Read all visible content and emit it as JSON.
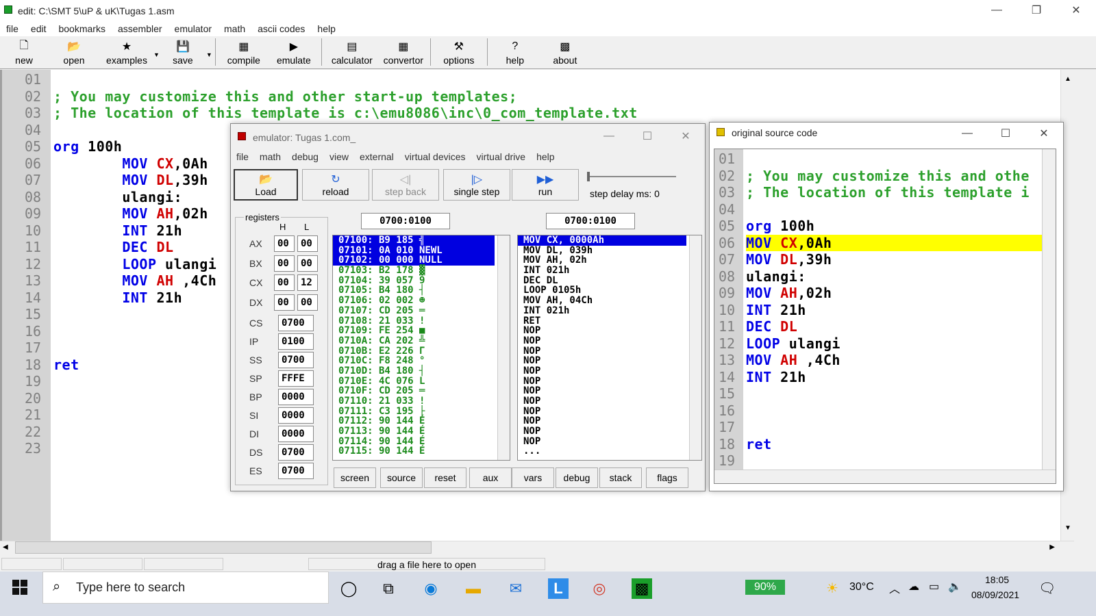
{
  "window": {
    "title": "edit: C:\\SMT 5\\uP & uK\\Tugas 1.asm",
    "min": "—",
    "max": "❐",
    "close": "✕"
  },
  "menu": [
    "file",
    "edit",
    "bookmarks",
    "assembler",
    "emulator",
    "math",
    "ascii codes",
    "help"
  ],
  "toolbar": [
    {
      "label": "new",
      "icon": "new-file-icon",
      "glyph": "🗋"
    },
    {
      "label": "open",
      "icon": "open-folder-icon",
      "glyph": "📂"
    },
    {
      "label": "examples",
      "icon": "star-icon",
      "glyph": "★"
    },
    {
      "label": "save",
      "icon": "floppy-disk-icon",
      "glyph": "💾"
    },
    {
      "label": "compile",
      "icon": "compile-icon",
      "glyph": "▦"
    },
    {
      "label": "emulate",
      "icon": "play-icon",
      "glyph": "▶"
    },
    {
      "label": "calculator",
      "icon": "calculator-icon",
      "glyph": "▤"
    },
    {
      "label": "convertor",
      "icon": "convertor-icon",
      "glyph": "▦"
    },
    {
      "label": "options",
      "icon": "tools-icon",
      "glyph": "⚒"
    },
    {
      "label": "help",
      "icon": "help-icon",
      "glyph": "?"
    },
    {
      "label": "about",
      "icon": "chip-icon",
      "glyph": "▩"
    }
  ],
  "editor": {
    "line_numbers": [
      "01",
      "02",
      "03",
      "04",
      "05",
      "06",
      "07",
      "08",
      "09",
      "10",
      "11",
      "12",
      "13",
      "14",
      "15",
      "16",
      "17",
      "18",
      "19",
      "20",
      "21",
      "22",
      "23"
    ],
    "lines": [
      [],
      [
        {
          "t": "; You may customize this and other start-up templates;",
          "c": "cmt"
        }
      ],
      [
        {
          "t": "; The location of this template is c:\\emu8086\\inc\\0_com_template.txt",
          "c": "cmt"
        }
      ],
      [],
      [
        {
          "t": "org ",
          "c": "kw"
        },
        {
          "t": "100h",
          "c": "txt"
        }
      ],
      [
        {
          "t": "        MOV ",
          "c": "kw"
        },
        {
          "t": "CX",
          "c": "reg"
        },
        {
          "t": ",0Ah",
          "c": "txt"
        }
      ],
      [
        {
          "t": "        MOV ",
          "c": "kw"
        },
        {
          "t": "DL",
          "c": "reg"
        },
        {
          "t": ",39h",
          "c": "txt"
        }
      ],
      [
        {
          "t": "        ulangi:",
          "c": "txt"
        }
      ],
      [
        {
          "t": "        MOV ",
          "c": "kw"
        },
        {
          "t": "AH",
          "c": "reg"
        },
        {
          "t": ",02h",
          "c": "txt"
        }
      ],
      [
        {
          "t": "        INT ",
          "c": "kw"
        },
        {
          "t": "21h",
          "c": "txt"
        }
      ],
      [
        {
          "t": "        DEC ",
          "c": "kw"
        },
        {
          "t": "DL",
          "c": "reg"
        }
      ],
      [
        {
          "t": "        LOOP ",
          "c": "kw"
        },
        {
          "t": "ulangi",
          "c": "txt"
        }
      ],
      [
        {
          "t": "        MOV ",
          "c": "kw"
        },
        {
          "t": "AH",
          "c": "reg"
        },
        {
          "t": " ,4Ch",
          "c": "txt"
        }
      ],
      [
        {
          "t": "        INT ",
          "c": "kw"
        },
        {
          "t": "21h",
          "c": "txt"
        }
      ],
      [],
      [],
      [],
      [
        {
          "t": "ret",
          "c": "kw"
        }
      ],
      [],
      [],
      [],
      [],
      []
    ]
  },
  "status": {
    "hint": "drag a file here to open"
  },
  "emulator": {
    "title": "emulator: Tugas 1.com_",
    "menu": [
      "file",
      "math",
      "debug",
      "view",
      "external",
      "virtual devices",
      "virtual drive",
      "help"
    ],
    "buttons": [
      {
        "label": "Load",
        "icon": "open-folder-icon",
        "glyph": "📂"
      },
      {
        "label": "reload",
        "icon": "reload-icon",
        "glyph": "↻"
      },
      {
        "label": "step back",
        "icon": "step-back-icon",
        "glyph": "◁|"
      },
      {
        "label": "single step",
        "icon": "single-step-icon",
        "glyph": "|▷"
      },
      {
        "label": "run",
        "icon": "run-icon",
        "glyph": "▶▶"
      }
    ],
    "step_delay_label": "step delay ms: 0",
    "registers_label": "registers",
    "h_label": "H",
    "l_label": "L",
    "regs8": [
      {
        "name": "AX",
        "h": "00",
        "l": "00"
      },
      {
        "name": "BX",
        "h": "00",
        "l": "00"
      },
      {
        "name": "CX",
        "h": "00",
        "l": "12"
      },
      {
        "name": "DX",
        "h": "00",
        "l": "00"
      }
    ],
    "regs16": [
      {
        "name": "CS",
        "v": "0700"
      },
      {
        "name": "IP",
        "v": "0100"
      },
      {
        "name": "SS",
        "v": "0700"
      },
      {
        "name": "SP",
        "v": "FFFE"
      },
      {
        "name": "BP",
        "v": "0000"
      },
      {
        "name": "SI",
        "v": "0000"
      },
      {
        "name": "DI",
        "v": "0000"
      },
      {
        "name": "DS",
        "v": "0700"
      },
      {
        "name": "ES",
        "v": "0700"
      }
    ],
    "addr_left": "0700:0100",
    "addr_right": "0700:0100",
    "memory": [
      "07100: B9 185 ╣",
      "07101: 0A 010 NEWL",
      "07102: 00 000 NULL",
      "07103: B2 178 ▓",
      "07104: 39 057 9",
      "07105: B4 180 ┤",
      "07106: 02 002 ☻",
      "07107: CD 205 ═",
      "07108: 21 033 !",
      "07109: FE 254 ■",
      "0710A: CA 202 ╩",
      "0710B: E2 226 Γ",
      "0710C: F8 248 °",
      "0710D: B4 180 ┤",
      "0710E: 4C 076 L",
      "0710F: CD 205 ═",
      "07110: 21 033 !",
      "07111: C3 195 ├",
      "07112: 90 144 É",
      "07113: 90 144 É",
      "07114: 90 144 É",
      "07115: 90 144 É"
    ],
    "disasm": [
      "MOV CX, 0000Ah",
      "MOV DL, 039h",
      "MOV AH, 02h",
      "INT 021h",
      "DEC DL",
      "LOOP 0105h",
      "MOV AH, 04Ch",
      "INT 021h",
      "RET",
      "NOP",
      "NOP",
      "NOP",
      "NOP",
      "NOP",
      "NOP",
      "NOP",
      "NOP",
      "NOP",
      "NOP",
      "NOP",
      "NOP",
      "..."
    ],
    "bottom_buttons": [
      "screen",
      "source",
      "reset",
      "aux",
      "vars",
      "debug",
      "stack",
      "flags"
    ]
  },
  "source": {
    "title": "original source code",
    "line_numbers": [
      "01",
      "02",
      "03",
      "04",
      "05",
      "06",
      "07",
      "08",
      "09",
      "10",
      "11",
      "12",
      "13",
      "14",
      "15",
      "16",
      "17",
      "18",
      "19"
    ],
    "lines": [
      [],
      [
        {
          "t": "; You may customize this and othe",
          "c": "cmt"
        }
      ],
      [
        {
          "t": "; The location of this template i",
          "c": "cmt"
        }
      ],
      [],
      [
        {
          "t": "org ",
          "c": "kw"
        },
        {
          "t": "100h",
          "c": "txt"
        }
      ],
      [
        {
          "t": "MOV ",
          "c": "kw"
        },
        {
          "t": "CX",
          "c": "reg"
        },
        {
          "t": ",0Ah",
          "c": "txt"
        }
      ],
      [
        {
          "t": "MOV ",
          "c": "kw"
        },
        {
          "t": "DL",
          "c": "reg"
        },
        {
          "t": ",39h",
          "c": "txt"
        }
      ],
      [
        {
          "t": "ulangi:",
          "c": "txt"
        }
      ],
      [
        {
          "t": "MOV ",
          "c": "kw"
        },
        {
          "t": "AH",
          "c": "reg"
        },
        {
          "t": ",02h",
          "c": "txt"
        }
      ],
      [
        {
          "t": "INT ",
          "c": "kw"
        },
        {
          "t": "21h",
          "c": "txt"
        }
      ],
      [
        {
          "t": "DEC ",
          "c": "kw"
        },
        {
          "t": "DL",
          "c": "reg"
        }
      ],
      [
        {
          "t": "LOOP ",
          "c": "kw"
        },
        {
          "t": "ulangi",
          "c": "txt"
        }
      ],
      [
        {
          "t": "MOV ",
          "c": "kw"
        },
        {
          "t": "AH",
          "c": "reg"
        },
        {
          "t": " ,4Ch",
          "c": "txt"
        }
      ],
      [
        {
          "t": "INT ",
          "c": "kw"
        },
        {
          "t": "21h",
          "c": "txt"
        }
      ],
      [],
      [],
      [],
      [
        {
          "t": "ret",
          "c": "kw"
        }
      ],
      []
    ],
    "highlight_line": 6
  },
  "taskbar": {
    "search_placeholder": "Type here to search",
    "battery": "90%",
    "weather": "30°C",
    "time": "18:05",
    "date": "08/09/2021"
  },
  "colors": {
    "keyword": "#0000e6",
    "register": "#d00000",
    "comment": "#2ca02c",
    "selection": "#0000e0",
    "highlight": "#ffff00"
  }
}
